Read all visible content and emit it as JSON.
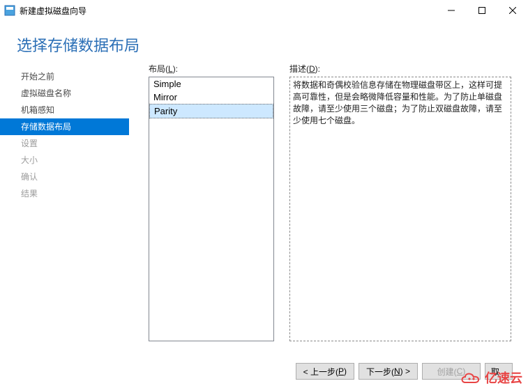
{
  "window": {
    "title": "新建虚拟磁盘向导",
    "heading": "选择存储数据布局"
  },
  "win_controls": {
    "min": "minimize",
    "max": "maximize",
    "close": "close"
  },
  "steps": [
    {
      "label": "开始之前",
      "state": "done"
    },
    {
      "label": "虚拟磁盘名称",
      "state": "done"
    },
    {
      "label": "机箱感知",
      "state": "done"
    },
    {
      "label": "存储数据布局",
      "state": "active"
    },
    {
      "label": "设置",
      "state": "future"
    },
    {
      "label": "大小",
      "state": "future"
    },
    {
      "label": "确认",
      "state": "future"
    },
    {
      "label": "结果",
      "state": "future"
    }
  ],
  "labels": {
    "layout_prefix": "布局(",
    "layout_accel": "L",
    "layout_suffix": "):",
    "desc_prefix": "描述(",
    "desc_accel": "D",
    "desc_suffix": "):"
  },
  "layouts": [
    {
      "name": "Simple",
      "selected": false
    },
    {
      "name": "Mirror",
      "selected": false
    },
    {
      "name": "Parity",
      "selected": true
    }
  ],
  "description": "将数据和奇偶校验信息存储在物理磁盘带区上，这样可提高可靠性，但是会略微降低容量和性能。为了防止单磁盘故障，请至少使用三个磁盘；为了防止双磁盘故障，请至少使用七个磁盘。",
  "buttons": {
    "prev": {
      "pre": "< 上一步(",
      "accel": "P",
      "post": ")"
    },
    "next": {
      "pre": "下一步(",
      "accel": "N",
      "post": ") >"
    },
    "create": {
      "pre": "创建(",
      "accel": "C",
      "post": ")",
      "disabled": true
    },
    "cancel": {
      "pre": "取",
      "accel": "",
      "post": ""
    }
  },
  "watermark": "亿速云"
}
